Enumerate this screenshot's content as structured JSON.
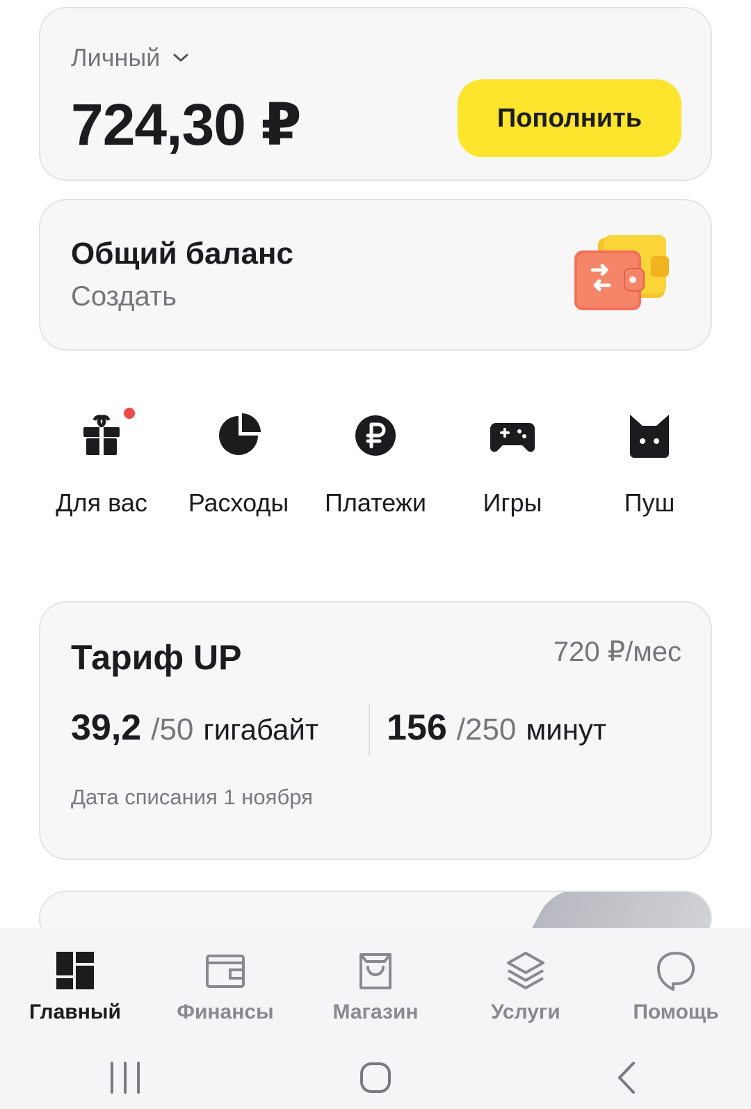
{
  "balance": {
    "account_label": "Личный",
    "amount": "724,30 ₽",
    "topup_label": "Пополнить"
  },
  "shared_balance": {
    "title": "Общий баланс",
    "action": "Создать"
  },
  "quick_actions": [
    {
      "label": "Для вас",
      "icon": "gift-icon",
      "has_notification": true
    },
    {
      "label": "Расходы",
      "icon": "pie-chart-icon"
    },
    {
      "label": "Платежи",
      "icon": "ruble-icon"
    },
    {
      "label": "Игры",
      "icon": "gamepad-icon"
    },
    {
      "label": "Пуш",
      "icon": "cat-icon"
    }
  ],
  "tariff": {
    "name": "Тариф UP",
    "price": "720 ₽/мес",
    "data_used": "39,2",
    "data_limit": "/50",
    "data_unit": "гигабайт",
    "minutes_used": "156",
    "minutes_limit": "/250",
    "minutes_unit": "минут",
    "charge_date": "Дата списания 1 ноября"
  },
  "bottom_nav": [
    {
      "label": "Главный",
      "icon": "dashboard-icon",
      "active": true
    },
    {
      "label": "Финансы",
      "icon": "wallet-icon"
    },
    {
      "label": "Магазин",
      "icon": "shopping-bag-icon"
    },
    {
      "label": "Услуги",
      "icon": "layers-icon"
    },
    {
      "label": "Помощь",
      "icon": "chat-bubble-icon"
    }
  ],
  "colors": {
    "accent_yellow": "#fce52c",
    "notification_red": "#ef4b47",
    "card_bg": "#f7f7f8",
    "text_primary": "#1c1c1e",
    "text_secondary": "#767679"
  }
}
